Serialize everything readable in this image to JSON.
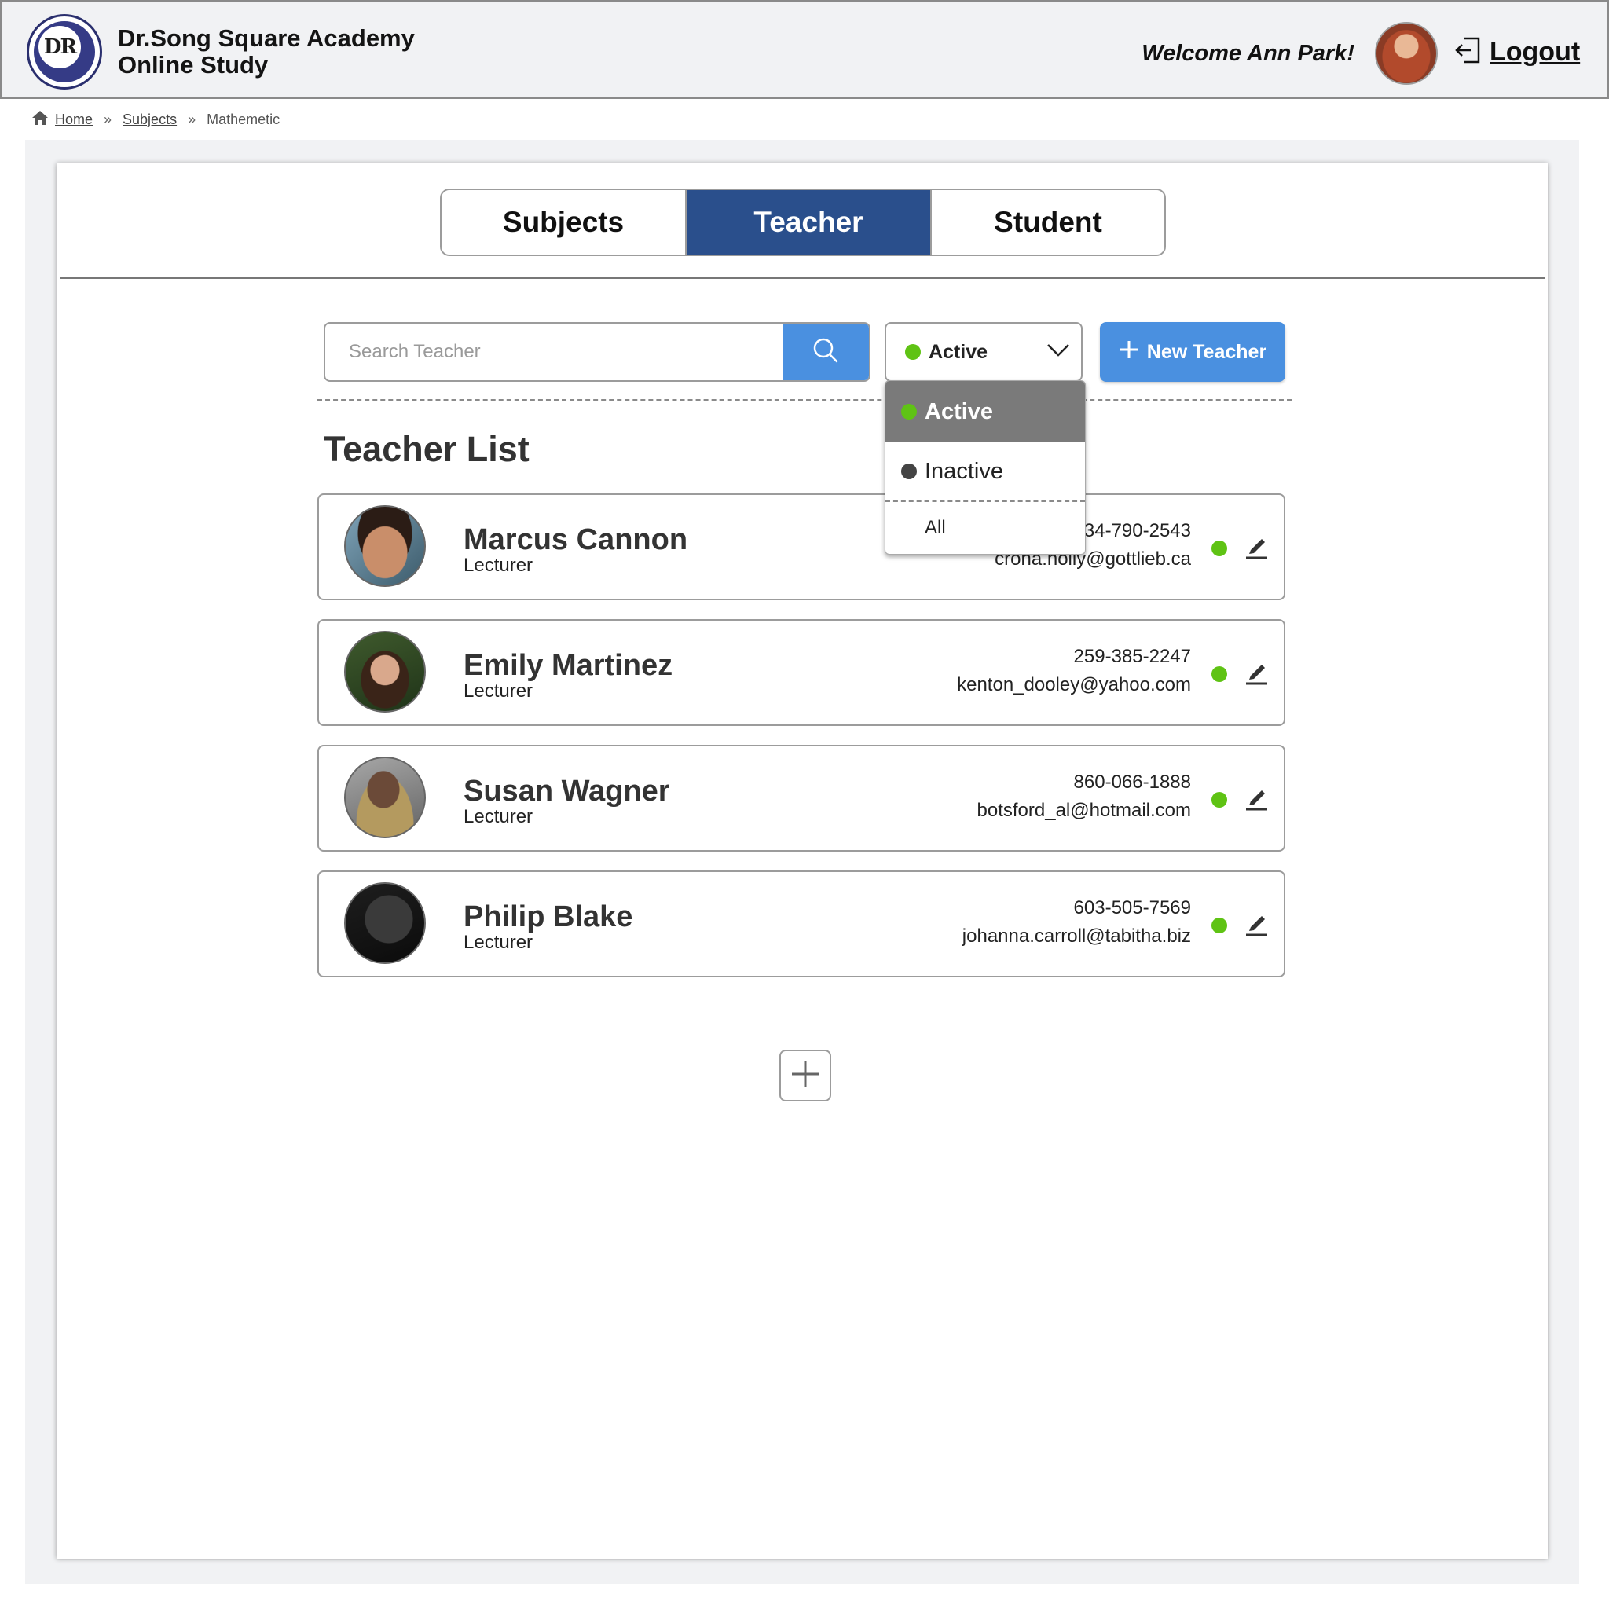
{
  "header": {
    "logo_text": "DR",
    "brand_line1": "Dr.Song Square Academy",
    "brand_line2": "Online Study",
    "welcome": "Welcome Ann Park!",
    "logout": "Logout"
  },
  "breadcrumb": {
    "home": "Home",
    "subjects": "Subjects",
    "current": "Mathemetic"
  },
  "tabs": [
    {
      "label": "Subjects",
      "active": false
    },
    {
      "label": "Teacher",
      "active": true
    },
    {
      "label": "Student",
      "active": false
    }
  ],
  "search": {
    "placeholder": "Search Teacher",
    "value": ""
  },
  "status_filter": {
    "selected": "Active",
    "options": [
      "Active",
      "Inactive",
      "All"
    ]
  },
  "new_button": "New Teacher",
  "list_title": "Teacher List",
  "teachers": [
    {
      "name": "Marcus Cannon",
      "role": "Lecturer",
      "phone": "234-790-2543",
      "email": "crona.holly@gottlieb.ca",
      "status": "active"
    },
    {
      "name": "Emily Martinez",
      "role": "Lecturer",
      "phone": "259-385-2247",
      "email": "kenton_dooley@yahoo.com",
      "status": "active"
    },
    {
      "name": "Susan Wagner",
      "role": "Lecturer",
      "phone": "860-066-1888",
      "email": "botsford_al@hotmail.com",
      "status": "active"
    },
    {
      "name": "Philip Blake",
      "role": "Lecturer",
      "phone": "603-505-7569",
      "email": "johanna.carroll@tabitha.biz",
      "status": "active"
    }
  ],
  "colors": {
    "accent_blue": "#4a90e0",
    "tab_active": "#2a4f8c",
    "status_active": "#5fc314",
    "status_inactive": "#444444"
  }
}
